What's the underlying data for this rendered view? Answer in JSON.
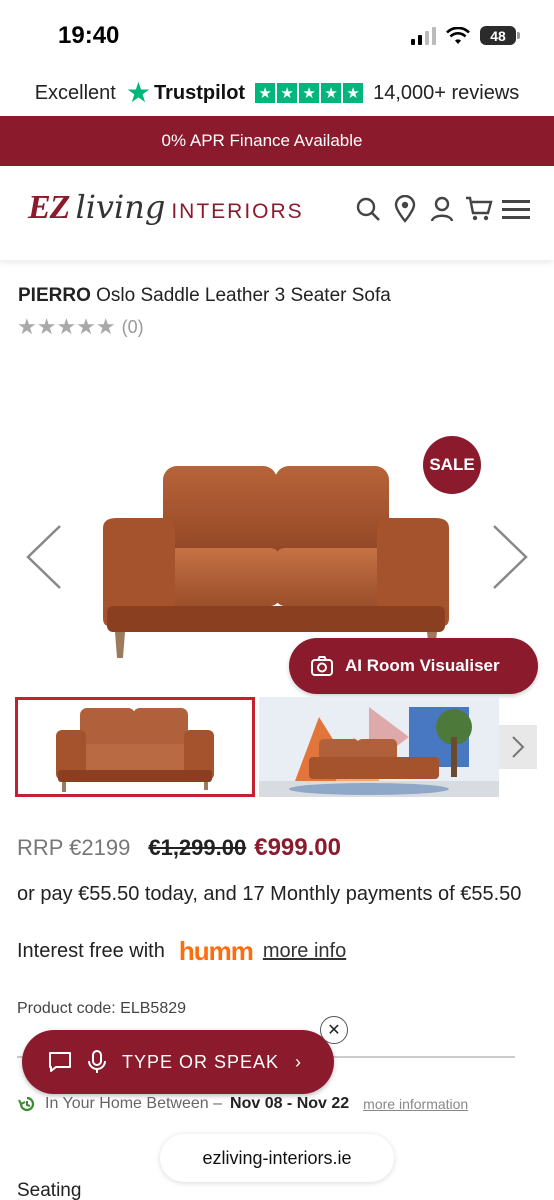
{
  "status": {
    "time": "19:40",
    "battery": "48"
  },
  "trust": {
    "rating_word": "Excellent",
    "brand": "Trustpilot",
    "reviews": "14,000+ reviews"
  },
  "promo": {
    "text": "0% APR Finance Available"
  },
  "header": {
    "logo_ez": "EZ",
    "logo_living": "living",
    "logo_interiors": "INTERIORS",
    "icons": [
      "search-icon",
      "location-icon",
      "account-icon",
      "cart-icon",
      "menu-icon"
    ]
  },
  "product": {
    "brand": "PIERRO",
    "name": "Oslo Saddle Leather 3 Seater Sofa",
    "rating_count": "(0)",
    "sale_badge": "SALE",
    "ai_button": "AI Room Visualiser"
  },
  "pricing": {
    "rrp": "RRP €2199",
    "old_price": "€1,299.00",
    "new_price": "€999.00",
    "finance_text": "or pay €55.50 today, and 17 Monthly payments of €55.50",
    "interest_free": "Interest free with",
    "humm": "humm",
    "more_info": "more info"
  },
  "product_code": "Product code: ELB5829",
  "chat": {
    "label": "TYPE OR SPEAK",
    "close": "✕"
  },
  "delivery": {
    "prefix": "In Your Home Between –",
    "dates": "Nov 08 - Nov 22",
    "more": "more information"
  },
  "url": "ezliving-interiors.ie",
  "section": {
    "seating": "Seating"
  },
  "colors": {
    "brand": "#8a1a2c",
    "trustpilot": "#00b67a",
    "humm": "#ff6c0c"
  }
}
